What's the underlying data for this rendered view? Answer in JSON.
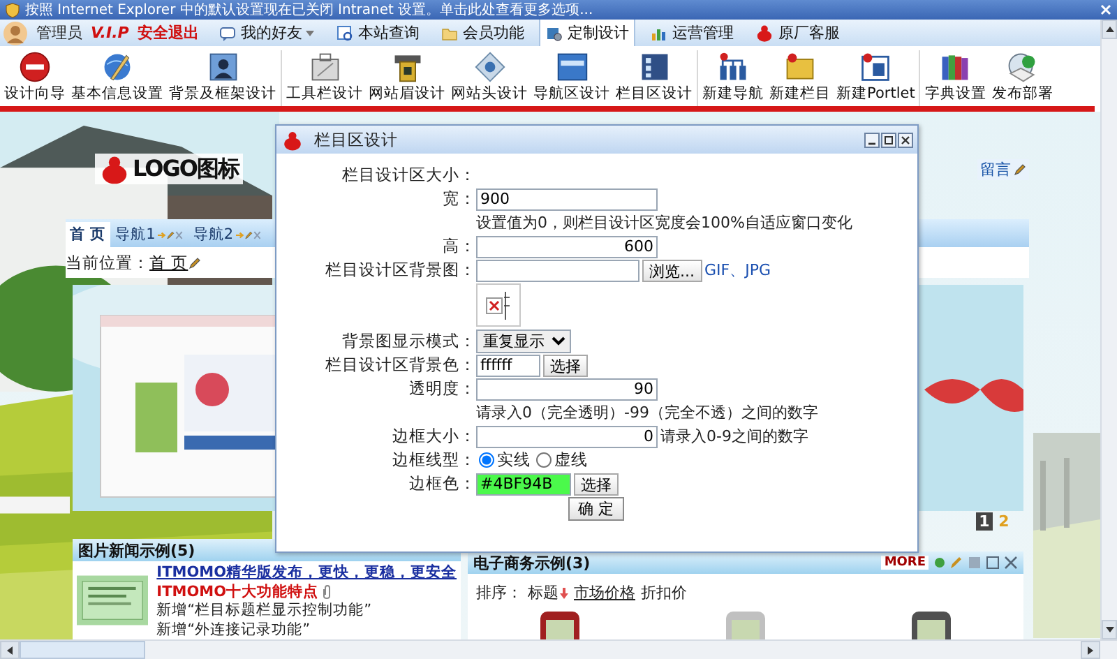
{
  "info_bar": {
    "text": "按照 Internet Explorer 中的默认设置现在已关闭 Intranet 设置。单击此处查看更多选项..."
  },
  "menu": {
    "user": "管理员",
    "badge": "V.I.P",
    "logout": "安全退出",
    "tabs": [
      {
        "label": "我的好友",
        "selected": false,
        "dropdown": true
      },
      {
        "label": "本站查询",
        "selected": false,
        "dropdown": false
      },
      {
        "label": "会员功能",
        "selected": false,
        "dropdown": false
      },
      {
        "label": "定制设计",
        "selected": true,
        "dropdown": false
      },
      {
        "label": "运营管理",
        "selected": false,
        "dropdown": false
      },
      {
        "label": "原厂客服",
        "selected": false,
        "dropdown": false
      }
    ]
  },
  "toolbar": {
    "groups": [
      [
        {
          "label": "设计向导"
        },
        {
          "label": "基本信息设置"
        },
        {
          "label": "背景及框架设计"
        }
      ],
      [
        {
          "label": "工具栏设计"
        },
        {
          "label": "网站眉设计"
        },
        {
          "label": "网站头设计"
        },
        {
          "label": "导航区设计"
        },
        {
          "label": "栏目区设计"
        }
      ],
      [
        {
          "label": "新建导航"
        },
        {
          "label": "新建栏目"
        },
        {
          "label": "新建Portlet"
        }
      ],
      [
        {
          "label": "字典设置"
        },
        {
          "label": "发布部署"
        }
      ]
    ]
  },
  "site": {
    "logo": "LOGO图标",
    "message_button": "留言",
    "nav": [
      {
        "label": "首 页",
        "selected": true,
        "editable": false
      },
      {
        "label": "导航1",
        "selected": false,
        "editable": true
      },
      {
        "label": "导航2",
        "selected": false,
        "editable": true
      }
    ],
    "breadcrumb": {
      "label": "当前位置：",
      "link": "首 页"
    },
    "pager": [
      {
        "label": "1",
        "selected": true
      },
      {
        "label": "2",
        "selected": false
      }
    ],
    "news_panel": {
      "title": "图片新闻示例(5)",
      "items": [
        {
          "kind": "headline",
          "text": "ITMOMO精华版发布，更快，更稳，更安全"
        },
        {
          "kind": "featured",
          "text": "ITMOMO十大功能特点"
        },
        {
          "kind": "plain",
          "text": "新增“栏目标题栏显示控制功能”"
        },
        {
          "kind": "plain",
          "text": "新增“外连接记录功能”"
        }
      ]
    },
    "shop_panel": {
      "title": "电子商务示例(3)",
      "more": "MORE",
      "sort_label": "排序：",
      "sort_options": [
        {
          "label": "标题",
          "selected": true,
          "underlined": false
        },
        {
          "label": "市场价格",
          "selected": false,
          "underlined": true
        },
        {
          "label": "折扣价",
          "selected": false,
          "underlined": false
        }
      ]
    }
  },
  "dialog": {
    "title": "栏目区设计",
    "rows": [
      {
        "kind": "heading",
        "label": "栏目设计区大小："
      },
      {
        "kind": "input",
        "label": "宽：",
        "value": "900"
      },
      {
        "kind": "hint",
        "text": "设置值为0，则栏目设计区宽度会100%自适应窗口变化"
      },
      {
        "kind": "number",
        "label": "高：",
        "value": "600"
      },
      {
        "kind": "file",
        "label": "栏目设计区背景图：",
        "button": "浏览...",
        "note": "GIF、JPG"
      },
      {
        "kind": "preview"
      },
      {
        "kind": "select",
        "label": "背景图显示模式：",
        "value": "重复显示"
      },
      {
        "kind": "color",
        "label": "栏目设计区背景色：",
        "value": "ffffff",
        "button": "选择",
        "color": "#ffffff"
      },
      {
        "kind": "number",
        "label": "透明度：",
        "value": "90"
      },
      {
        "kind": "hint",
        "text": "请录入0（完全透明）-99（完全不透）之间的数字"
      },
      {
        "kind": "number",
        "label": "边框大小：",
        "value": "0",
        "note": "请录入0-9之间的数字"
      },
      {
        "kind": "radio",
        "label": "边框线型：",
        "options": [
          {
            "label": "实线",
            "selected": true
          },
          {
            "label": "虚线",
            "selected": false
          }
        ]
      },
      {
        "kind": "color",
        "label": "边框色：",
        "value": "#4BF94B",
        "button": "选择",
        "color": "#4bf94b"
      }
    ],
    "submit": "确 定"
  }
}
